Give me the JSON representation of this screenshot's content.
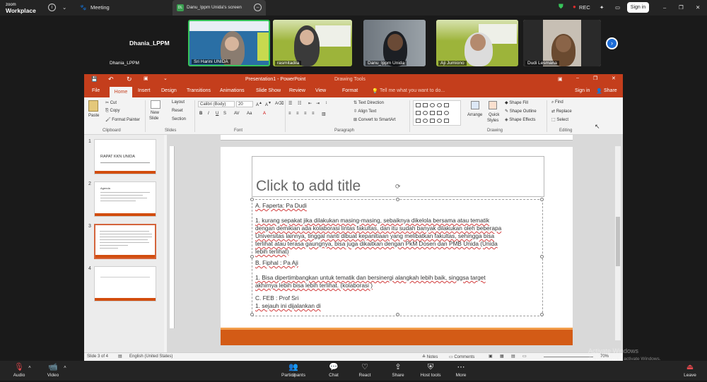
{
  "zoom": {
    "brand_top": "zoom",
    "brand_bottom": "Workplace",
    "meeting_label": "Meeting",
    "share_tab": "Danu_lppm Unida's screen",
    "share_badge": "DL",
    "rec": "REC",
    "signin": "Sign in",
    "speaker_name": "Dhania_LPPM",
    "speaker_label": "Dhania_LPPM",
    "participants": [
      "Sri Harini UNIDA",
      "rasmitadila",
      "Danu_lppm Unida",
      "Aji Jumiono",
      "Dudi Lesmana"
    ],
    "bottom": {
      "audio": "Audio",
      "video": "Video",
      "participants": "Participants",
      "participants_count": "10",
      "chat": "Chat",
      "react": "React",
      "share": "Share",
      "host_tools": "Host tools",
      "more": "More",
      "leave": "Leave"
    },
    "colors": {
      "bar": "#242424",
      "accent_blue": "#1d6dd8",
      "rec_red": "#e22d2d",
      "shield_green": "#37c45a"
    }
  },
  "ppt": {
    "window_title": "Presentation1 - PowerPoint",
    "drawing_tools": "Drawing Tools",
    "tabs": [
      "File",
      "Home",
      "Insert",
      "Design",
      "Transitions",
      "Animations",
      "Slide Show",
      "Review",
      "View",
      "Format"
    ],
    "tell_me": "Tell me what you want to do...",
    "sign_in": "Sign in",
    "share": "Share",
    "ribbon": {
      "paste": "Paste",
      "cut": "Cut",
      "copy": "Copy",
      "format_painter": "Format Painter",
      "clipboard": "Clipboard",
      "new_slide_1": "New",
      "new_slide_2": "Slide",
      "layout": "Layout",
      "reset": "Reset",
      "section": "Section",
      "slides": "Slides",
      "font_name": "Calibri (Body)",
      "font_size": "20",
      "font": "Font",
      "text_direction": "Text Direction",
      "align_text": "Align Text",
      "convert_smartart": "Convert to SmartArt",
      "paragraph": "Paragraph",
      "arrange": "Arrange",
      "quick_styles_1": "Quick",
      "quick_styles_2": "Styles",
      "shape_fill": "Shape Fill",
      "shape_outline": "Shape Outline",
      "shape_effects": "Shape Effects",
      "drawing": "Drawing",
      "find": "Find",
      "replace": "Replace",
      "select": "Select",
      "editing": "Editing"
    },
    "thumbs": [
      {
        "num": "1",
        "title": "RAPAT KKN UNIDA"
      },
      {
        "num": "2",
        "title": "Agenda"
      },
      {
        "num": "3",
        "title": ""
      },
      {
        "num": "4",
        "title": ""
      }
    ],
    "slide": {
      "title_placeholder": "Click to add title",
      "lines": [
        "A. Faperta: Pa Dudi",
        "1. kurang sepakat jika dilakukan masing-masing, sebaiknya dikelola bersama atau tematik",
        "dengan demikian ada kolaborasi lintas fakultas, dan itu sudah banyak dilakukan oleh beberapa",
        "Universitas lainnya, tinggal nanti dibuat kepanitiaan yang melibatkan fakultas, sehingga bisa",
        "terlihat atau terasa gaungnya, bisa juga dikaitkan dengan PkM Dosen dan PMB Unida (Unida",
        "lebih terlihat)",
        "B. Fiphal : Pa Aji",
        "1. Bisa dipertimbangkan untuk tematik dan bersinergi alangkah lebih baik, singgsa target",
        "akhirnya lebih bisa lebih terlihat. (kolaborasi )",
        "C. FEB : Prof Sri",
        "1. sejauh ini dijalankan di"
      ]
    },
    "status": {
      "slide_of": "Slide 3 of 4",
      "language": "English (United States)",
      "notes": "Notes",
      "comments": "Comments",
      "zoom": "70%"
    },
    "colors": {
      "accent": "#c43e1c",
      "slide_bar": "#d35b16"
    }
  },
  "watermark": {
    "line1": "Activate Windows",
    "line2": "Go to Settings to activate Windows."
  }
}
